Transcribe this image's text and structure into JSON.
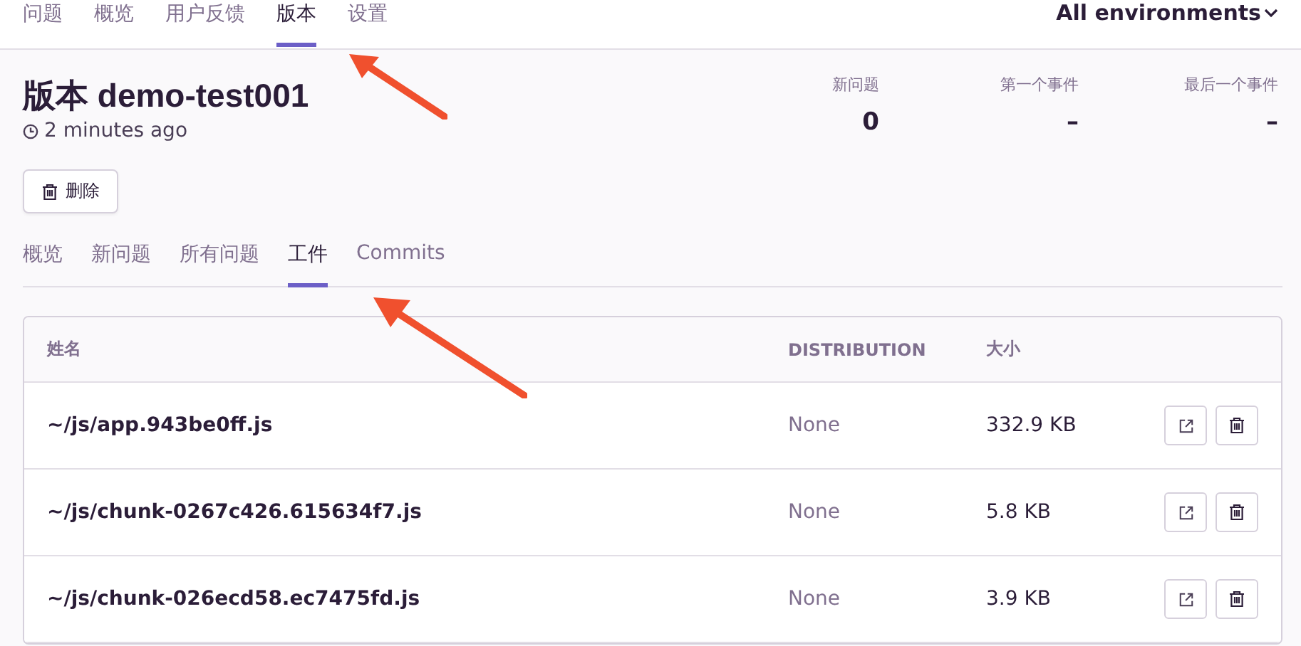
{
  "nav": {
    "tabs": [
      {
        "label": "问题",
        "selected": false
      },
      {
        "label": "概览",
        "selected": false
      },
      {
        "label": "用户反馈",
        "selected": false
      },
      {
        "label": "版本",
        "selected": true
      },
      {
        "label": "设置",
        "selected": false
      }
    ],
    "environment": "All environments"
  },
  "release": {
    "title": "版本 demo-test001",
    "age": "2 minutes ago",
    "delete": "删除"
  },
  "stats": [
    {
      "label": "新问题",
      "value": "0"
    },
    {
      "label": "第一个事件",
      "value": "–"
    },
    {
      "label": "最后一个事件",
      "value": "–"
    }
  ],
  "tabs": [
    {
      "label": "概览",
      "selected": false
    },
    {
      "label": "新问题",
      "selected": false
    },
    {
      "label": "所有问题",
      "selected": false
    },
    {
      "label": "工件",
      "selected": true
    },
    {
      "label": "Commits",
      "selected": false
    }
  ],
  "table": {
    "columns": [
      "姓名",
      "DISTRIBUTION",
      "大小"
    ],
    "rows": [
      {
        "name": "~/js/app.943be0ff.js",
        "distribution": "None",
        "size": "332.9 KB"
      },
      {
        "name": "~/js/chunk-0267c426.615634f7.js",
        "distribution": "None",
        "size": "5.8 KB"
      },
      {
        "name": "~/js/chunk-026ecd58.ec7475fd.js",
        "distribution": "None",
        "size": "3.9 KB"
      }
    ]
  }
}
